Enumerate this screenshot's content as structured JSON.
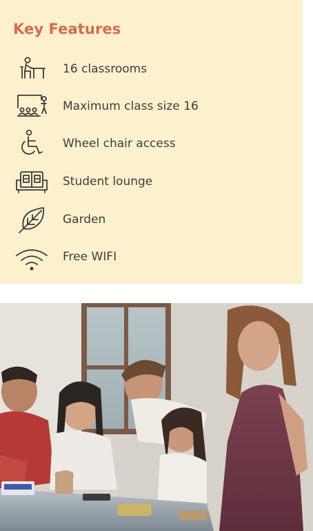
{
  "features": {
    "title": "Key Features",
    "items": [
      {
        "label": "16 classrooms",
        "icon": "classroom-desk-icon"
      },
      {
        "label": "Maximum class size 16",
        "icon": "class-size-icon"
      },
      {
        "label": "Wheel chair access",
        "icon": "wheelchair-icon"
      },
      {
        "label": "Student lounge",
        "icon": "sofa-icon"
      },
      {
        "label": "Garden",
        "icon": "leaf-icon"
      },
      {
        "label": "Free WIFI",
        "icon": "wifi-icon"
      }
    ]
  },
  "colors": {
    "panel_background": "#fdf0cc",
    "title": "#d46b52",
    "text": "#3d3d3d",
    "icon_stroke": "#3a3a3a"
  },
  "photo": {
    "subject": "students-around-table-photo"
  }
}
